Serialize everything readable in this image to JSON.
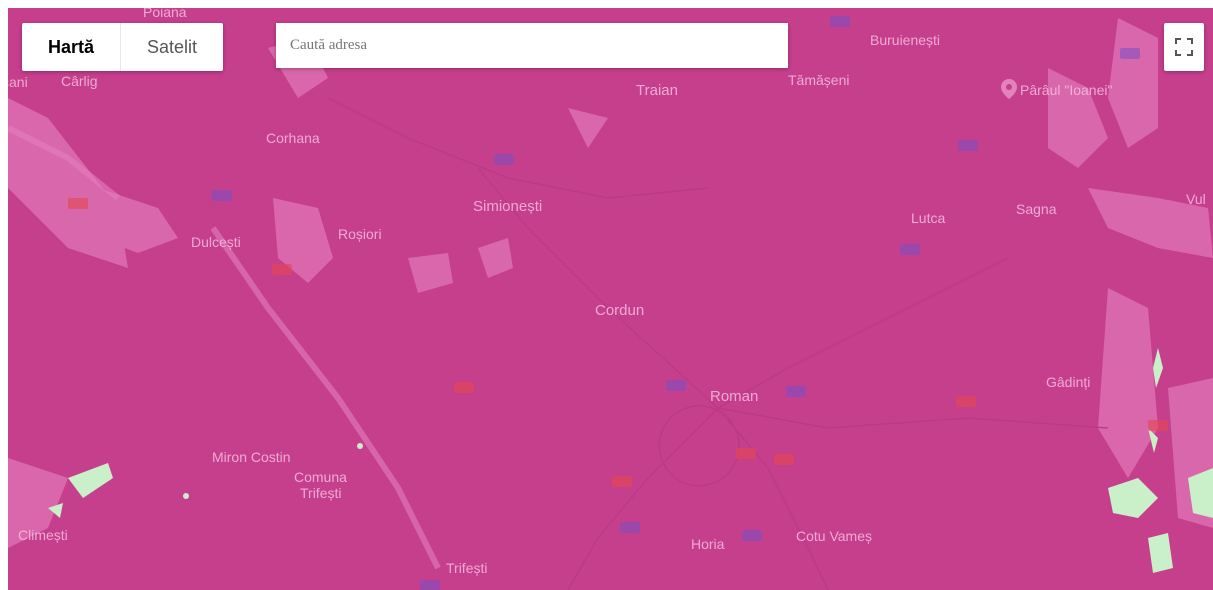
{
  "controls": {
    "map_type_buttons": [
      "Hartă",
      "Satelit"
    ],
    "active_map_type": "Hartă",
    "search_placeholder": "Caută adresa",
    "fullscreen_icon": "fullscreen-icon"
  },
  "map": {
    "overlay_color": "#c63f8c",
    "light_patch_color": "#e07ab8",
    "green_patch_color": "#c9f0c9",
    "poi": {
      "label": "Pârâul \"Ioanei\"",
      "icon": "map-pin-icon"
    },
    "places": [
      "Poiana",
      "cani",
      "Cârlig",
      "Traian",
      "Buruienești",
      "Tămășeni",
      "Corhana",
      "Simionești",
      "Lutca",
      "Sagna",
      "Vul",
      "Dulcești",
      "Roșiori",
      "Cordun",
      "Roman",
      "Gâdinți",
      "Miron Costin",
      "Comuna",
      "Trifești",
      "Climești",
      "Horia",
      "Cotu Vameș",
      "Trifești"
    ]
  }
}
